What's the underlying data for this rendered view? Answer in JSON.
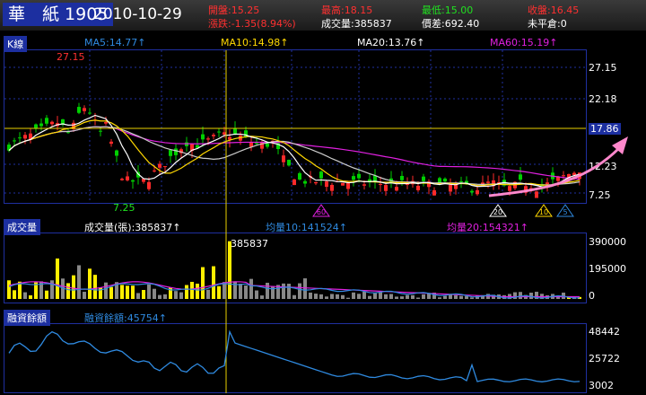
{
  "header": {
    "name": "華　紙 1905",
    "date": "2010-10-29"
  },
  "quote": {
    "open": "開盤:15.25",
    "change": "漲跌:-1.35(8.94%)",
    "high": "最高:18.15",
    "volume": "成交量:385837",
    "low": "最低:15.00",
    "amplitude": "價差:692.40",
    "close": "收盤:16.45",
    "unchanged": "未平倉:0"
  },
  "kline": {
    "tab": "K線",
    "ma5": "MA5:14.77↑",
    "ma10": "MA10:14.98↑",
    "ma20": "MA20:13.76↑",
    "ma60": "MA60:15.19↑",
    "high_label": "27.15",
    "low_label": "7.25",
    "cursor_price": "17.86",
    "ticks": [
      "27.15",
      "22.18",
      "17.86",
      "12.23",
      "7.25"
    ],
    "markers": [
      "60",
      "20",
      "10",
      "5"
    ]
  },
  "volume": {
    "tab": "成交量",
    "vol": "成交量(張):385837↑",
    "avg10": "均量10:141524↑",
    "avg20": "均量20:154321↑",
    "peak_label": "385837",
    "ticks": [
      "390000",
      "195000",
      "0"
    ]
  },
  "margin": {
    "tab": "融資餘額",
    "value": "融資餘額:45754↑",
    "ticks": [
      "48442",
      "25722",
      "3002"
    ]
  },
  "colors": {
    "up": "#ff2a2a",
    "down": "#00d000",
    "ma5": "#ffffff",
    "ma10": "#ffd800",
    "ma20": "#ffffff",
    "ma60": "#e020e0",
    "margin_line": "#2f8ae0",
    "cursor": "#e8d000",
    "annotation": "#ff88cc"
  }
}
